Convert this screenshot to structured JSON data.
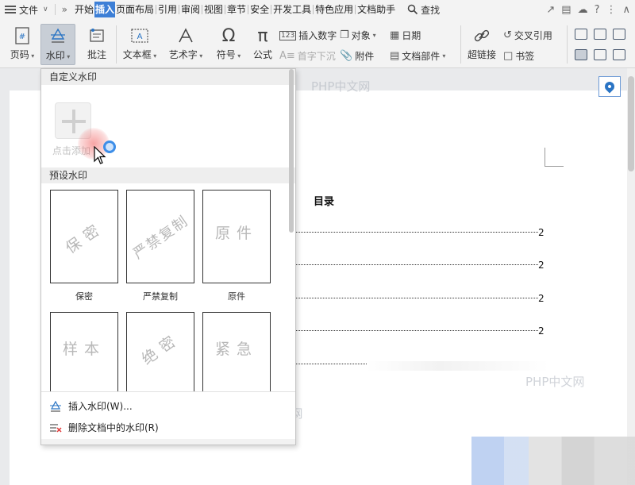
{
  "menubar": {
    "file_label": "文件",
    "tabs": [
      {
        "label": "开始",
        "active": false
      },
      {
        "label": "插入",
        "active": true
      },
      {
        "label": "页面布局",
        "active": false
      },
      {
        "label": "引用",
        "active": false
      },
      {
        "label": "审阅",
        "active": false
      },
      {
        "label": "视图",
        "active": false
      },
      {
        "label": "章节",
        "active": false
      },
      {
        "label": "安全",
        "active": false
      },
      {
        "label": "开发工具",
        "active": false
      },
      {
        "label": "特色应用",
        "active": false
      },
      {
        "label": "文档助手",
        "active": false
      }
    ],
    "search_label": "查找",
    "accent_color": "#3d7fd6"
  },
  "ribbon": {
    "page_number": "页码",
    "watermark": "水印",
    "comment": "批注",
    "textbox": "文本框",
    "wordart": "艺术字",
    "symbol": "符号",
    "formula": "公式",
    "insert_number": "插入数字",
    "drop_cap": "首字下沉",
    "object": "对象",
    "attachment": "附件",
    "date": "日期",
    "doc_parts": "文档部件",
    "hyperlink": "超链接",
    "cross_reference": "交叉引用",
    "bookmark": "书签"
  },
  "panel": {
    "custom_title": "自定义水印",
    "add_label": "点击添加",
    "preset_title": "预设水印",
    "presets": [
      {
        "mark": "保密",
        "caption": "保密"
      },
      {
        "mark": "严禁复制",
        "caption": "严禁复制"
      },
      {
        "mark": "原件",
        "caption": "原件"
      },
      {
        "mark": "样本",
        "caption": ""
      },
      {
        "mark": "绝密",
        "caption": ""
      },
      {
        "mark": "紧急",
        "caption": ""
      }
    ],
    "insert_watermark": "插入水印(W)...",
    "delete_watermark": "删除文档中的水印(R)"
  },
  "document": {
    "toc_title": "目录",
    "toc_page_numbers": [
      "2",
      "2",
      "2",
      "2"
    ]
  },
  "watermarks": {
    "site": "PHP中文网"
  }
}
